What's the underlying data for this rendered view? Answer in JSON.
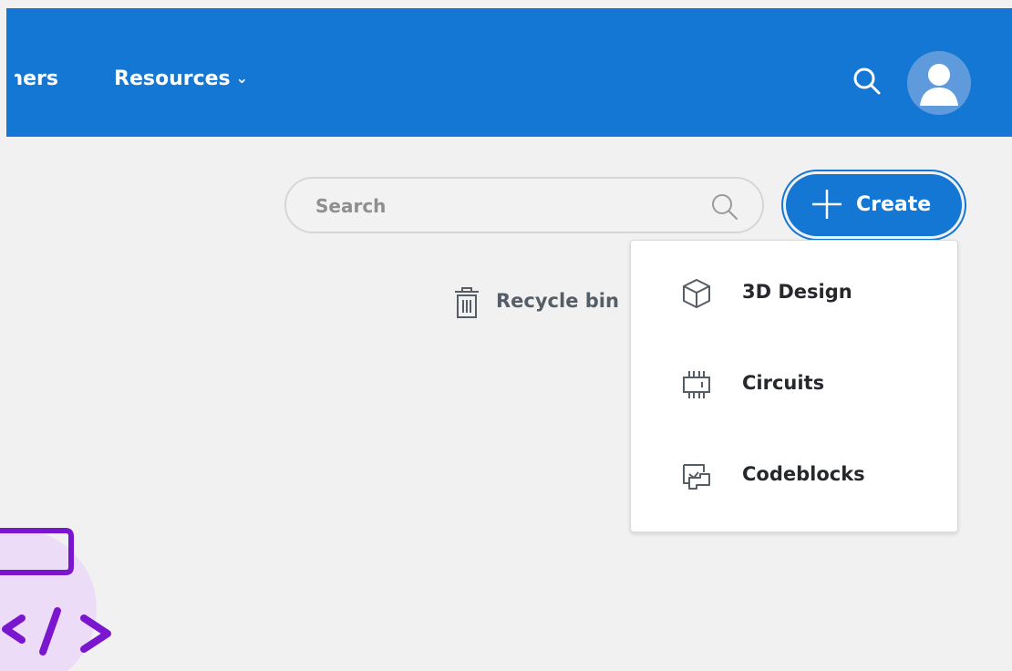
{
  "header": {
    "nav_partners": "Partners",
    "nav_resources": "Resources",
    "caret": "⌄",
    "bg_color": "#1477d4"
  },
  "search": {
    "placeholder": "Search"
  },
  "create": {
    "label": "Create"
  },
  "recycle_bin": {
    "label": "Recycle bin"
  },
  "create_menu": {
    "items": [
      {
        "label": "3D Design",
        "icon": "cube-icon"
      },
      {
        "label": "Circuits",
        "icon": "circuit-chip-icon"
      },
      {
        "label": "Codeblocks",
        "icon": "codeblocks-icon"
      }
    ]
  },
  "colors": {
    "accent": "#1477d4",
    "background": "#f1f1f1",
    "illustration_purple": "#7b16cf",
    "illustration_bg": "#eddcf8"
  }
}
